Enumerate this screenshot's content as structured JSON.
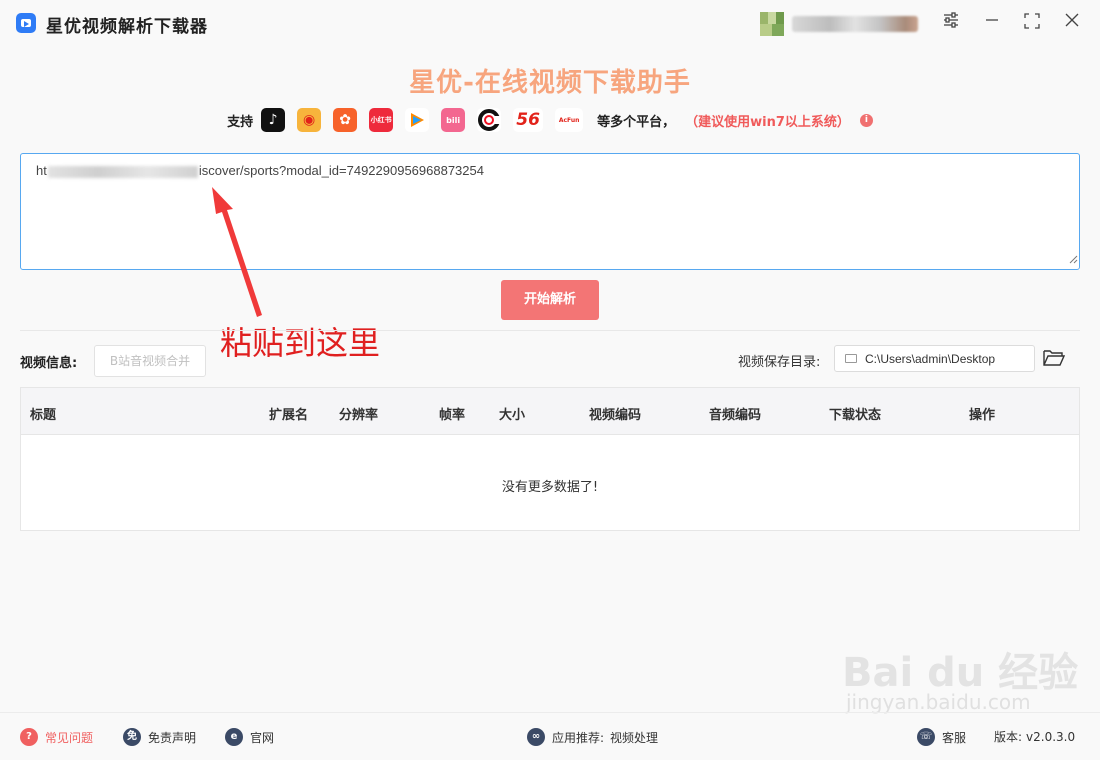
{
  "window": {
    "title": "星优视频解析下载器",
    "controls": [
      "settings-icon",
      "minimize-icon",
      "maximize-icon",
      "close-icon"
    ]
  },
  "header": {
    "headline": "星优-在线视频下载助手",
    "support_label": "支持",
    "platforms": [
      {
        "name": "douyin",
        "label": "♪",
        "color": "#111111"
      },
      {
        "name": "weibo",
        "label": "◉",
        "color": "#f7b43c"
      },
      {
        "name": "kuaishou",
        "label": "✿",
        "color": "#f7622a"
      },
      {
        "name": "xiaohongshu",
        "label": "小红书",
        "color": "#ee2a3c"
      },
      {
        "name": "tencent-video",
        "label": "▶",
        "color": "#ffffff"
      },
      {
        "name": "bilibili",
        "label": "bili",
        "color": "#f36790"
      },
      {
        "name": "cctv",
        "label": "C",
        "color": "#ffffff"
      },
      {
        "name": "56",
        "label": "56",
        "color": "#ffffff"
      },
      {
        "name": "acfun",
        "label": "AcFun",
        "color": "#ffffff"
      }
    ],
    "platform_more": "等多个平台，",
    "platform_note": "（建议使用win7以上系统）",
    "info_icon": "i"
  },
  "url_input": {
    "prefix": "ht",
    "suffix": "iscover/sports?modal_id=7492290956968873254"
  },
  "parse_button": "开始解析",
  "annotation": "粘贴到这里",
  "video_info": {
    "label": "视频信息:",
    "merge_button": "B站音视频合并",
    "save_dir_label": "视频保存目录:",
    "save_dir_value": "C:\\Users\\admin\\Desktop"
  },
  "table": {
    "columns": [
      "标题",
      "扩展名",
      "分辨率",
      "帧率",
      "大小",
      "视频编码",
      "音频编码",
      "下载状态",
      "操作"
    ],
    "empty_message": "没有更多数据了!"
  },
  "footer": {
    "faq": "常见问题",
    "disclaimer": "免责声明",
    "website": "官网",
    "app_recommend_label": "应用推荐:",
    "app_recommend_value": "视频处理",
    "support": "客服",
    "version_label": "版本:",
    "version": "v2.0.3.0"
  },
  "watermark": {
    "main": "Bai du 经验",
    "sub": "jingyan.baidu.com"
  },
  "colors": {
    "headline": "#f7a57e",
    "accent_red": "#f37575",
    "input_border": "#57a8f0",
    "note_red": "#f05a5a"
  }
}
